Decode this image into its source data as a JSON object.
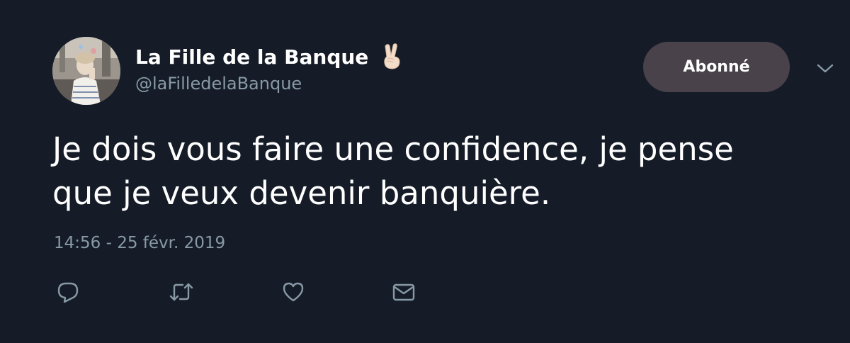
{
  "tweet": {
    "display_name": "La Fille de la Banque",
    "emoji": "✌🏻",
    "handle": "@laFilledelaBanque",
    "follow_label": "Abonné",
    "text_line1": "Je dois vous faire une confidence, je pense",
    "text_line2": "que je veux devenir banquière.",
    "timestamp": "14:56 - 25 févr. 2019"
  },
  "icons": {
    "menu": "chevron-down-icon",
    "reply": "reply-icon",
    "retweet": "retweet-icon",
    "like": "heart-icon",
    "message": "envelope-icon"
  },
  "colors": {
    "background": "#151c28",
    "secondary_text": "#8899a6",
    "button": "#4a424a",
    "icon": "#8899a6"
  }
}
